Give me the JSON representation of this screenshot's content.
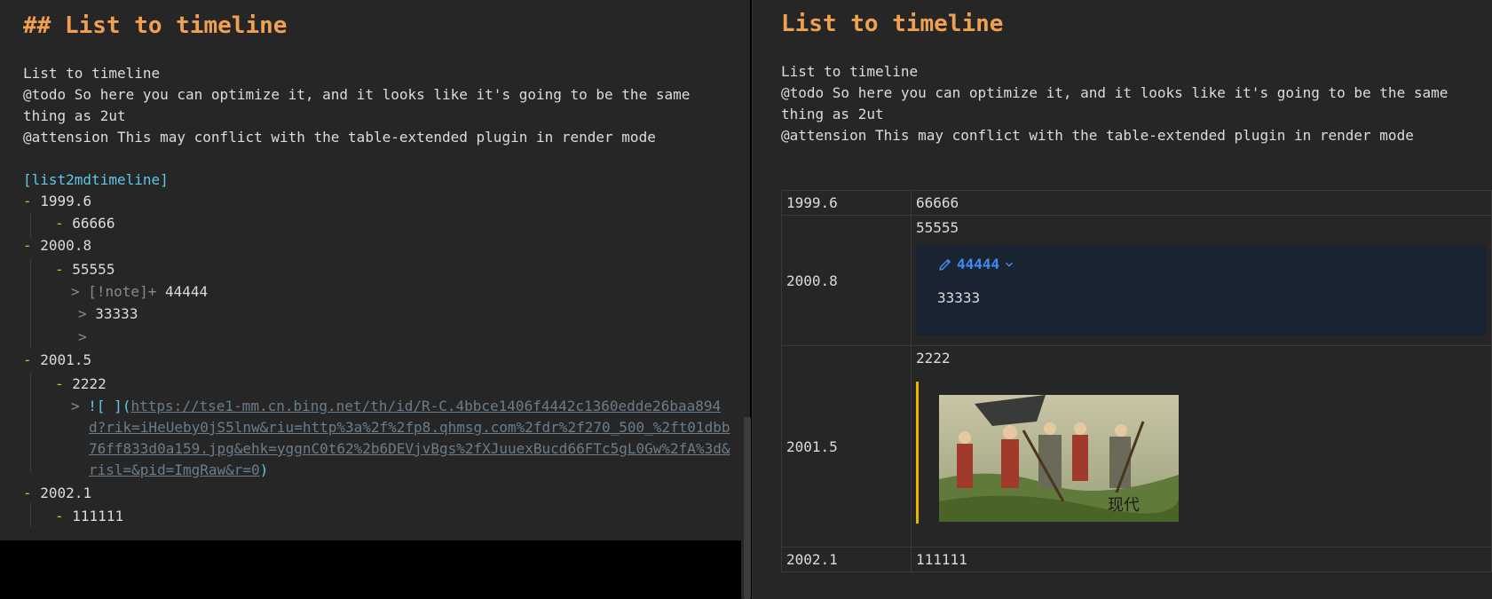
{
  "editor": {
    "heading": "## List to timeline",
    "intro": [
      "List to timeline",
      "@todo So here you can optimize it, and it looks like it's going to be the same",
      "thing as 2ut",
      "@attension This may conflict with the table-extended plugin in render mode"
    ],
    "code_tag": "[list2mdtimeline]",
    "list": {
      "d1": "1999.6",
      "d1_child": "66666",
      "d2": "2000.8",
      "d2_child": "55555",
      "d2_callout_marker": "> [!note]+",
      "d2_callout_title": "44444",
      "d2_quote_marker": ">",
      "d2_quote_text": "33333",
      "d2_empty_quote": ">",
      "d3": "2001.5",
      "d3_child": "2222",
      "d3_quote_marker": ">",
      "d3_image_open": "![ ](",
      "d3_url_lines": [
        "https://tse1-mm.cn.bing.net/th/id/R-C.4bbce1406f4442c1360edde26baa894",
        "d?rik=iHeUeby0jS5lnw&riu=http%3a%2f%2fp8.qhmsg.com%2fdr%2f270_500_%2ft01dbb",
        "76ff833d0a159.jpg&ehk=yggnC0t62%2b6DEVjvBgs%2fXJuuexBucd66FTc5gL0Gw%2fA%3d&",
        "risl=&pid=ImgRaw&r=0"
      ],
      "d3_image_close": ")",
      "d4": "2002.1",
      "d4_child": "111111",
      "dash": "-"
    }
  },
  "preview": {
    "heading": "List to timeline",
    "intro": [
      "List to timeline",
      "@todo So here you can optimize it, and it looks like it's going to be the same",
      "thing as 2ut",
      "@attension This may conflict with the table-extended plugin in render mode"
    ],
    "timeline": {
      "r1_date": "1999.6",
      "r1_text": "66666",
      "r2_date": "2000.8",
      "r2_text": "55555",
      "r2_callout_title": "44444",
      "r2_callout_body": "33333",
      "r3_date": "2001.5",
      "r3_text": "2222",
      "r4_date": "2002.1",
      "r4_text": "111111"
    }
  },
  "colors": {
    "heading": "#f0a04e",
    "list_dash": "#e6b42d",
    "code_tag": "#5fc8e8",
    "callout_accent": "#3d8cf0",
    "quote_bar": "#e8b400"
  },
  "icons": {
    "callout_icon": "pencil-icon",
    "callout_fold": "chevron-down-icon"
  }
}
